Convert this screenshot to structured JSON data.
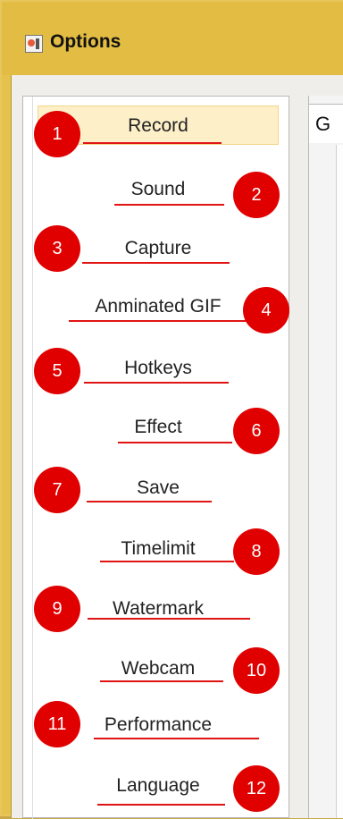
{
  "window": {
    "title": "Options"
  },
  "tabs": [
    {
      "label": "G"
    }
  ],
  "sidebar": {
    "items": [
      {
        "label": "Record",
        "badge": "1",
        "selected": true
      },
      {
        "label": "Sound",
        "badge": "2"
      },
      {
        "label": "Capture",
        "badge": "3"
      },
      {
        "label": "Anminated GIF",
        "badge": "4"
      },
      {
        "label": "Hotkeys",
        "badge": "5"
      },
      {
        "label": "Effect",
        "badge": "6"
      },
      {
        "label": "Save",
        "badge": "7"
      },
      {
        "label": "Timelimit",
        "badge": "8"
      },
      {
        "label": "Watermark",
        "badge": "9"
      },
      {
        "label": "Webcam",
        "badge": "10"
      },
      {
        "label": "Performance",
        "badge": "11"
      },
      {
        "label": "Language",
        "badge": "12"
      }
    ]
  },
  "colors": {
    "badge": "#e10000",
    "underline": "#e11414",
    "selected_bg": "#fdf0c8"
  }
}
